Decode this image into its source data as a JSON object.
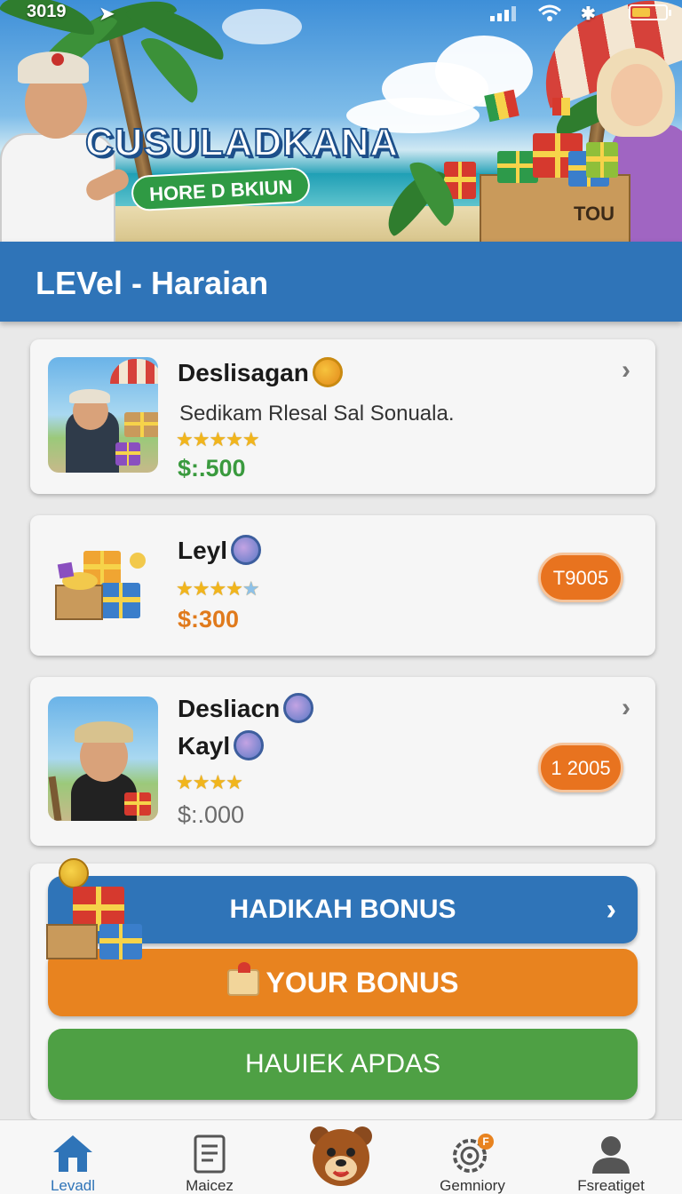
{
  "status_bar": {
    "time": "3019",
    "icons": [
      "signal-icon",
      "wifi-icon",
      "bluetooth-icon",
      "battery-icon"
    ]
  },
  "hero": {
    "title": "CUSULADKANA",
    "subtitle": "HORE D BKIUN",
    "box_text": "TOU"
  },
  "level_header": {
    "title": "LEVel - Haraian"
  },
  "cards": [
    {
      "name": "Deslisagan",
      "description": "Sedikam Rlesal Sal Sonuala.",
      "stars": "★★★★★",
      "rating": 5,
      "price": "$:.500",
      "price_color": "#3a9a3e"
    },
    {
      "name": "Leyl",
      "stars": "★★★★",
      "star_extra": "★",
      "rating": 4,
      "price": "$:300",
      "price_color": "#e07a1c",
      "pill": "T9005"
    },
    {
      "name": "Desliacn",
      "name2": "Kayl",
      "stars": "★★★★",
      "rating": 4,
      "price": "$:.000",
      "price_color": "#6b6b6b",
      "pill": "1 2005"
    }
  ],
  "bonus": {
    "primary_label": "HADIKAH BONUS",
    "secondary_label": "YOUR BONUS",
    "tertiary_label": "HAUIEK APDAS"
  },
  "bottom_nav": [
    {
      "label": "Levadl",
      "icon": "home-icon",
      "active": true
    },
    {
      "label": "Maicez",
      "icon": "document-icon",
      "active": false
    },
    {
      "label": "",
      "icon": "bear-mascot-icon",
      "active": false
    },
    {
      "label": "Gemniory",
      "icon": "target-gear-icon",
      "active": false,
      "badge": "F"
    },
    {
      "label": "Fsreatiget",
      "icon": "profile-icon",
      "active": false
    }
  ],
  "colors": {
    "primary_blue": "#2f74b8",
    "orange": "#e8831f",
    "green": "#4ea044",
    "price_green": "#3a9a3e"
  }
}
